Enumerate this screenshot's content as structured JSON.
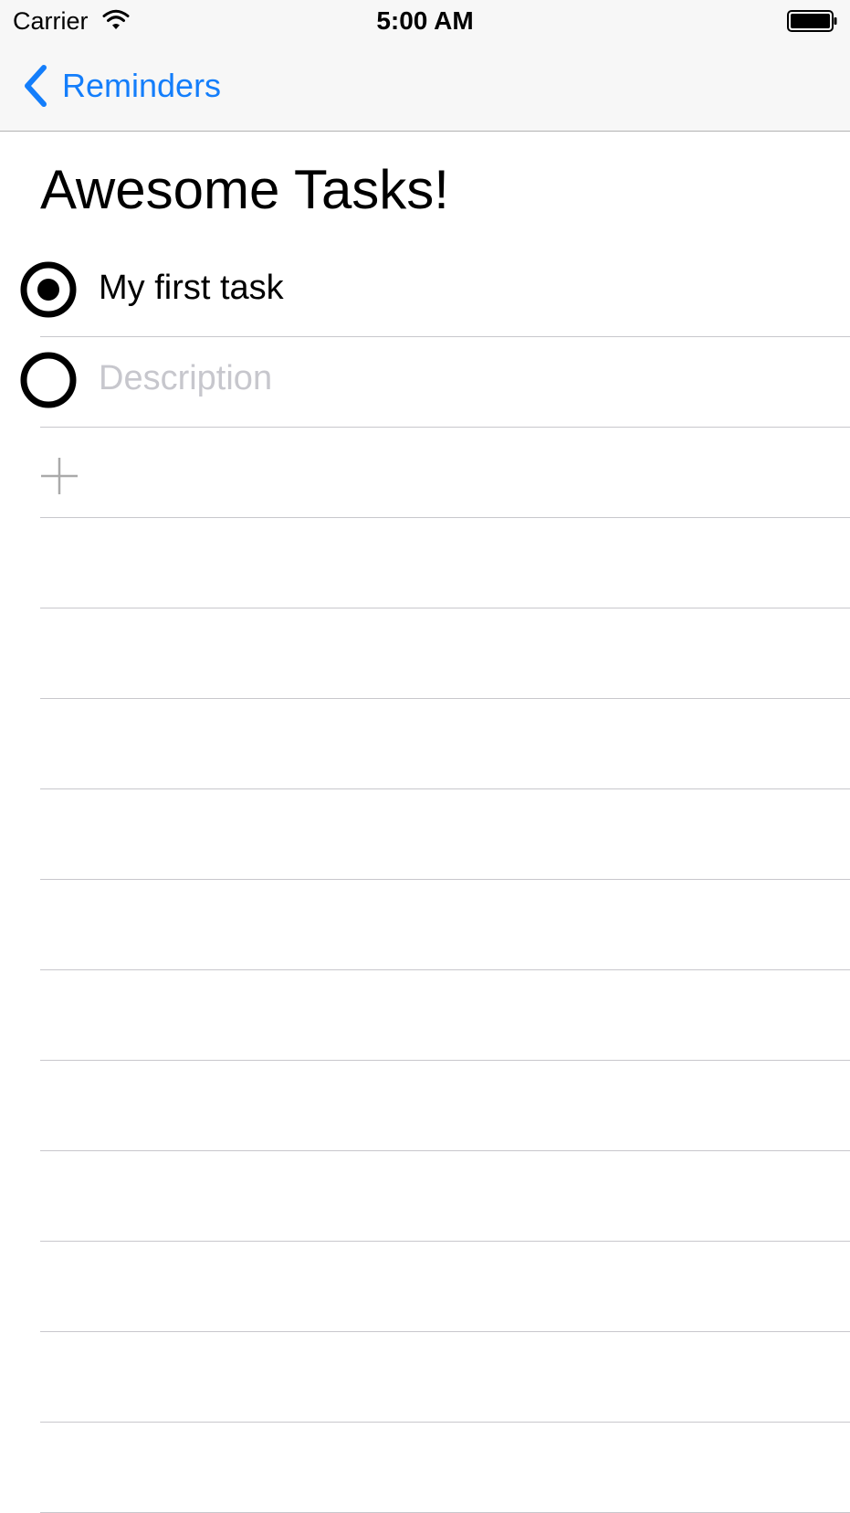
{
  "status_bar": {
    "carrier": "Carrier",
    "time": "5:00 AM",
    "wifi_icon": "wifi-icon",
    "battery_icon": "battery-full-icon"
  },
  "nav": {
    "back_label": "Reminders",
    "back_icon": "chevron-left-icon",
    "accent_color": "#147efb"
  },
  "page": {
    "title": "Awesome Tasks!"
  },
  "tasks": [
    {
      "text": "My first task",
      "state": "selected",
      "icon": "radio-selected-icon"
    }
  ],
  "new_task": {
    "value": "",
    "placeholder": "Description",
    "icon": "radio-unselected-icon"
  },
  "add_row": {
    "icon": "plus-icon"
  },
  "colors": {
    "separator": "#c8c7cc",
    "placeholder": "#c7c7cd",
    "nav_background": "#f7f7f7",
    "plus_icon": "#aaaaaa"
  }
}
